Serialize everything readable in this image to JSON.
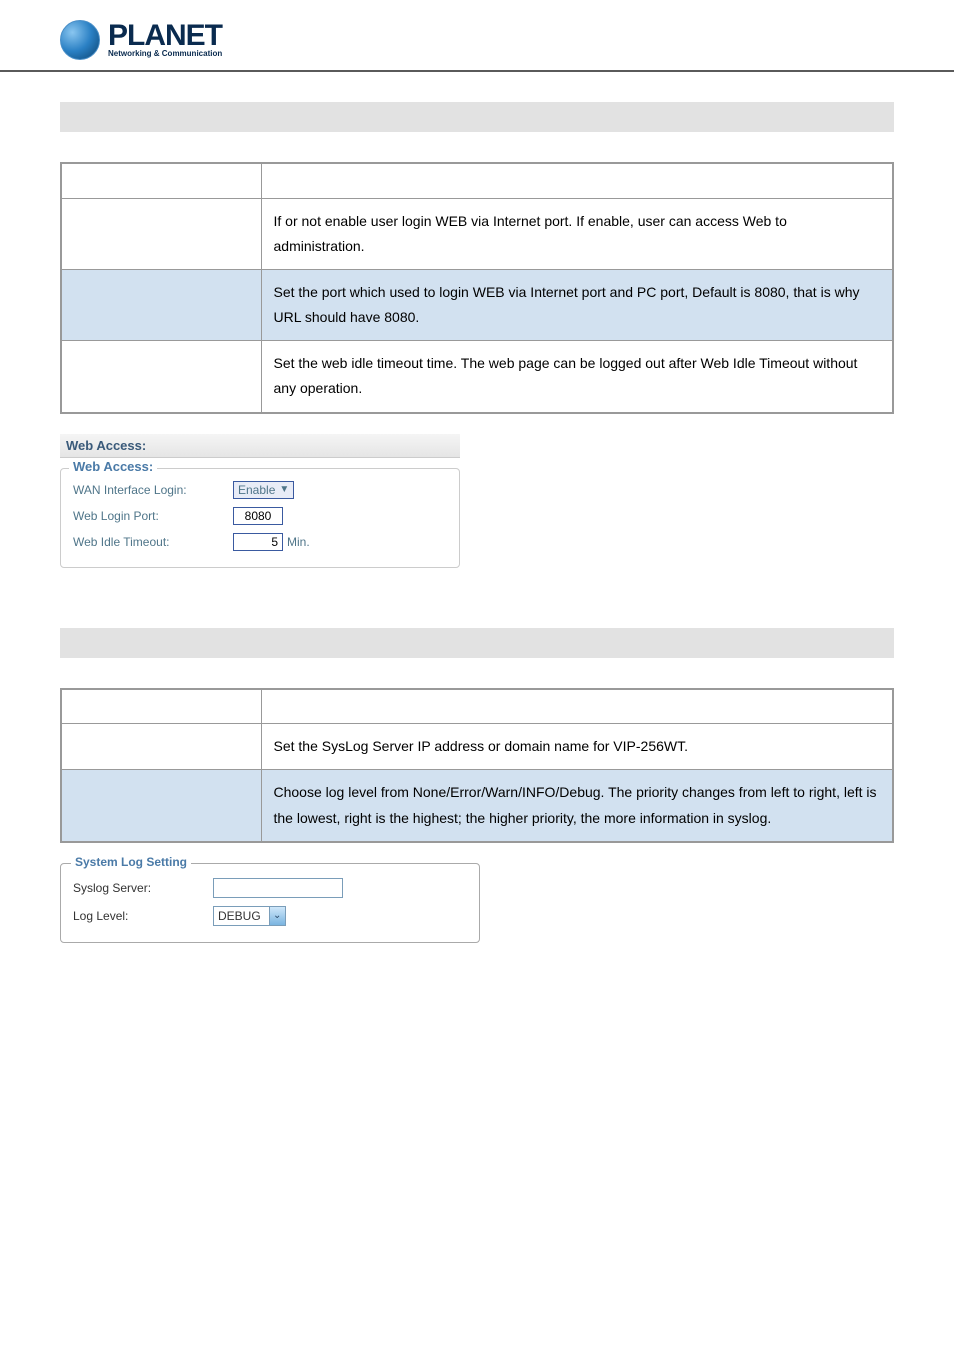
{
  "logo": {
    "name": "PLANET",
    "tag": "Networking & Communication"
  },
  "webAccessTable": {
    "rows": [
      {
        "label": "",
        "desc": "If or not enable user login WEB via Internet port.\nIf enable, user can access Web to administration.",
        "alt": false
      },
      {
        "label": "",
        "desc": "Set the port which used to login WEB via Internet port and PC port, Default is 8080, that is why URL should have 8080.",
        "alt": true
      },
      {
        "label": "",
        "desc": "Set the web idle timeout time.\nThe web page can be logged out after Web Idle Timeout without any operation.",
        "alt": false
      }
    ]
  },
  "webAccessShot": {
    "header": "Web Access:",
    "legend": "Web Access:",
    "fields": {
      "wanLabel": "WAN Interface Login:",
      "wanValue": "Enable",
      "portLabel": "Web Login Port:",
      "portValue": "8080",
      "idleLabel": "Web Idle Timeout:",
      "idleValue": "5",
      "idleUnit": "Min."
    }
  },
  "syslogTable": {
    "rows": [
      {
        "label": "",
        "desc": "Set the SysLog Server IP address or domain name for VIP-256WT.",
        "alt": false
      },
      {
        "label": "",
        "desc": "Choose log level from None/Error/Warn/INFO/Debug.\nThe priority changes from left to right, left is the lowest, right is the highest; the higher priority, the more information in syslog.",
        "alt": true
      }
    ]
  },
  "syslogShot": {
    "legend": "System Log Setting",
    "serverLabel": "Syslog Server:",
    "serverValue": "",
    "levelLabel": "Log Level:",
    "levelValue": "DEBUG"
  }
}
